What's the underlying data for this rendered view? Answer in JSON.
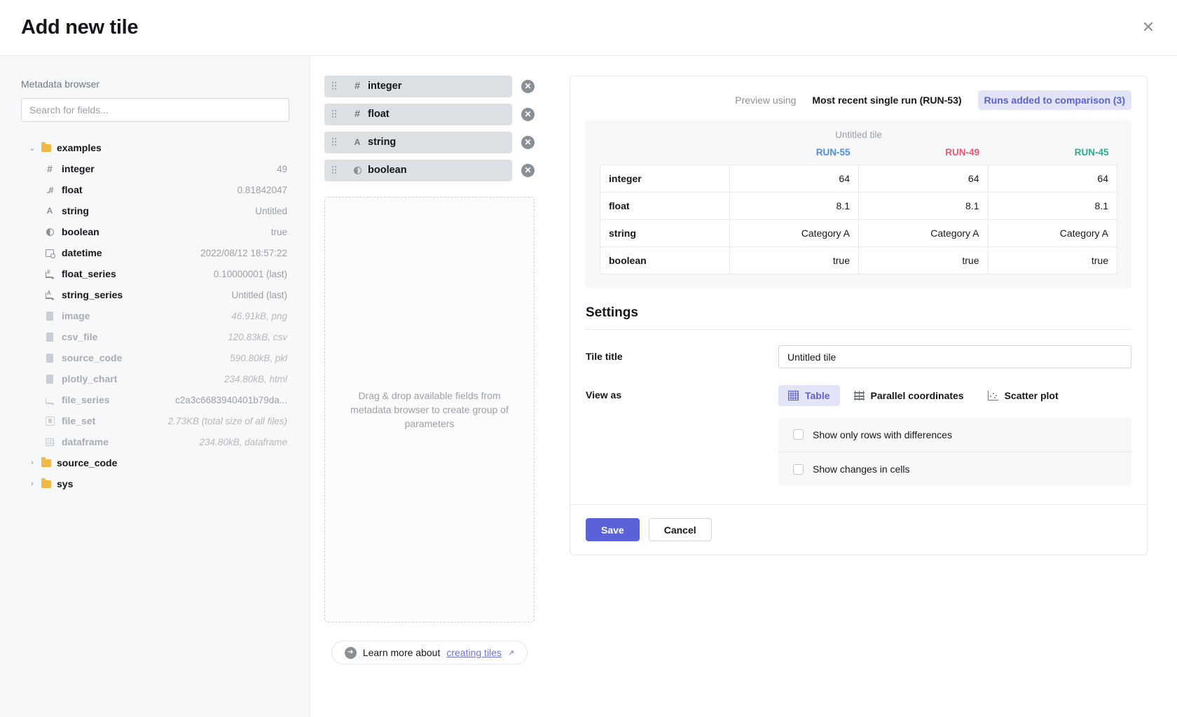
{
  "header": {
    "title": "Add new tile",
    "close_icon": "close-icon"
  },
  "sidebar": {
    "label": "Metadata browser",
    "search_placeholder": "Search for fields...",
    "search_value": "",
    "tree": [
      {
        "type": "folder",
        "name": "examples",
        "expanded": true,
        "caret": "⌄"
      },
      {
        "type": "field",
        "icon": "hash-icon",
        "name": "integer",
        "value": "49",
        "muted": false,
        "italic": false
      },
      {
        "type": "field",
        "icon": "float-icon",
        "name": "float",
        "value": "0.81842047",
        "muted": false,
        "italic": false
      },
      {
        "type": "field",
        "icon": "string-icon",
        "name": "string",
        "value": "Untitled",
        "muted": false,
        "italic": false
      },
      {
        "type": "field",
        "icon": "boolean-icon",
        "name": "boolean",
        "value": "true",
        "muted": false,
        "italic": false
      },
      {
        "type": "field",
        "icon": "calendar-icon",
        "name": "datetime",
        "value": "2022/08/12 18:57:22",
        "muted": false,
        "italic": false
      },
      {
        "type": "field",
        "icon": "float-series-icon",
        "name": "float_series",
        "value": "0.10000001 (last)",
        "muted": false,
        "italic": false
      },
      {
        "type": "field",
        "icon": "string-series-icon",
        "name": "string_series",
        "value": "Untitled (last)",
        "muted": false,
        "italic": false
      },
      {
        "type": "field",
        "icon": "file-icon",
        "name": "image",
        "value": "46.91kB, png",
        "muted": true,
        "italic": true
      },
      {
        "type": "field",
        "icon": "file-icon",
        "name": "csv_file",
        "value": "120.83kB, csv",
        "muted": true,
        "italic": true
      },
      {
        "type": "field",
        "icon": "file-icon",
        "name": "source_code",
        "value": "590.80kB, pkl",
        "muted": true,
        "italic": true
      },
      {
        "type": "field",
        "icon": "file-icon",
        "name": "plotly_chart",
        "value": "234.80kB, html",
        "muted": true,
        "italic": true
      },
      {
        "type": "field",
        "icon": "file-series-icon",
        "name": "file_series",
        "value": "c2a3c6683940401b79da...",
        "muted": true,
        "italic": false
      },
      {
        "type": "field",
        "icon": "file-set-icon",
        "name": "file_set",
        "value": "2.73KB (total size of all files)",
        "muted": true,
        "italic": true
      },
      {
        "type": "field",
        "icon": "dataframe-icon",
        "name": "dataframe",
        "value": "234.80kB, dataframe",
        "muted": true,
        "italic": true
      },
      {
        "type": "folder",
        "name": "source_code",
        "expanded": false,
        "caret": "›"
      },
      {
        "type": "folder",
        "name": "sys",
        "expanded": false,
        "caret": "›"
      }
    ]
  },
  "middle": {
    "chips": [
      {
        "icon": "hash-icon",
        "label": "integer",
        "remove_icon": "remove-icon"
      },
      {
        "icon": "hash-icon",
        "label": "float",
        "remove_icon": "remove-icon"
      },
      {
        "icon": "string-icon",
        "label": "string",
        "remove_icon": "remove-icon"
      },
      {
        "icon": "boolean-icon",
        "label": "boolean",
        "remove_icon": "remove-icon"
      }
    ],
    "dropzone_text": "Drag & drop available fields from metadata browser to create group of parameters",
    "learn_prefix": "Learn more about",
    "learn_link": "creating tiles",
    "learn_arrow_icon": "arrow-right-circle-icon",
    "learn_external_icon": "external-link-icon"
  },
  "preview": {
    "label": "Preview using",
    "option_single": "Most recent single run (RUN-53)",
    "option_comparison": "Runs added to comparison (3)",
    "active_option": "comparison",
    "tile_name": "Untitled tile",
    "columns": [
      {
        "name": "RUN-55",
        "color": "#4a90e2"
      },
      {
        "name": "RUN-49",
        "color": "#f0566e"
      },
      {
        "name": "RUN-45",
        "color": "#2eac8f"
      }
    ],
    "rows": [
      {
        "field": "integer",
        "values": [
          "64",
          "64",
          "64"
        ]
      },
      {
        "field": "float",
        "values": [
          "8.1",
          "8.1",
          "8.1"
        ]
      },
      {
        "field": "string",
        "values": [
          "Category A",
          "Category A",
          "Category A"
        ]
      },
      {
        "field": "boolean",
        "values": [
          "true",
          "true",
          "true"
        ]
      }
    ]
  },
  "settings": {
    "title": "Settings",
    "tile_title_label": "Tile title",
    "tile_title_value": "Untitled tile",
    "view_as_label": "View as",
    "view_options": [
      {
        "label": "Table",
        "icon": "table-icon",
        "active": true
      },
      {
        "label": "Parallel coordinates",
        "icon": "parallel-coordinates-icon",
        "active": false
      },
      {
        "label": "Scatter plot",
        "icon": "scatter-plot-icon",
        "active": false
      }
    ],
    "checkboxes": [
      {
        "label": "Show only rows with differences",
        "checked": false
      },
      {
        "label": "Show changes in cells",
        "checked": false
      }
    ],
    "save_label": "Save",
    "cancel_label": "Cancel"
  },
  "colors": {
    "accent": "#5b61d6",
    "accent_bg": "#e4e4f8",
    "folder": "#f0b849"
  }
}
